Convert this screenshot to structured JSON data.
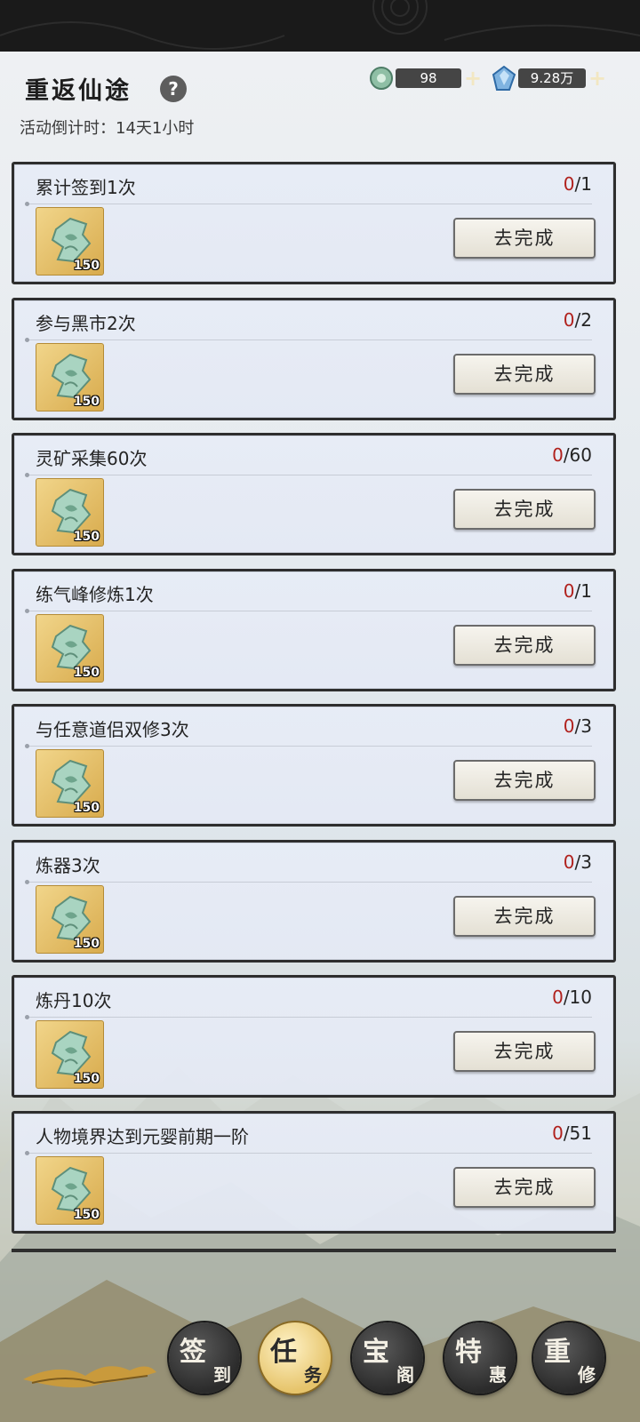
{
  "header": {
    "title": "重返仙途",
    "help_icon": "?",
    "countdown_label": "活动倒计时：",
    "countdown_value": "14天1小时"
  },
  "resources": [
    {
      "icon": "jade-token-icon",
      "value": "98",
      "plus": "+"
    },
    {
      "icon": "spirit-crystal-icon",
      "value": "9.28万",
      "plus": "+"
    }
  ],
  "tasks": [
    {
      "name": "累计签到1次",
      "current": "0",
      "total": "/1",
      "reward_qty": "150",
      "button": "去完成"
    },
    {
      "name": "参与黑市2次",
      "current": "0",
      "total": "/2",
      "reward_qty": "150",
      "button": "去完成"
    },
    {
      "name": "灵矿采集60次",
      "current": "0",
      "total": "/60",
      "reward_qty": "150",
      "button": "去完成"
    },
    {
      "name": "练气峰修炼1次",
      "current": "0",
      "total": "/1",
      "reward_qty": "150",
      "button": "去完成"
    },
    {
      "name": "与任意道侣双修3次",
      "current": "0",
      "total": "/3",
      "reward_qty": "150",
      "button": "去完成"
    },
    {
      "name": "炼器3次",
      "current": "0",
      "total": "/3",
      "reward_qty": "150",
      "button": "去完成"
    },
    {
      "name": "炼丹10次",
      "current": "0",
      "total": "/10",
      "reward_qty": "150",
      "button": "去完成"
    },
    {
      "name": "人物境界达到元婴前期一阶",
      "current": "0",
      "total": "/51",
      "reward_qty": "150",
      "button": "去完成"
    }
  ],
  "nav": [
    {
      "big": "签",
      "small": "到",
      "active": false
    },
    {
      "big": "任",
      "small": "务",
      "active": true
    },
    {
      "big": "宝",
      "small": "阁",
      "active": false
    },
    {
      "big": "特",
      "small": "惠",
      "active": false
    },
    {
      "big": "重",
      "small": "修",
      "active": false
    }
  ],
  "colors": {
    "progress_current": "#b0201c",
    "panel_border": "#2e2e2e",
    "reward_bg": "#e4bd63"
  }
}
